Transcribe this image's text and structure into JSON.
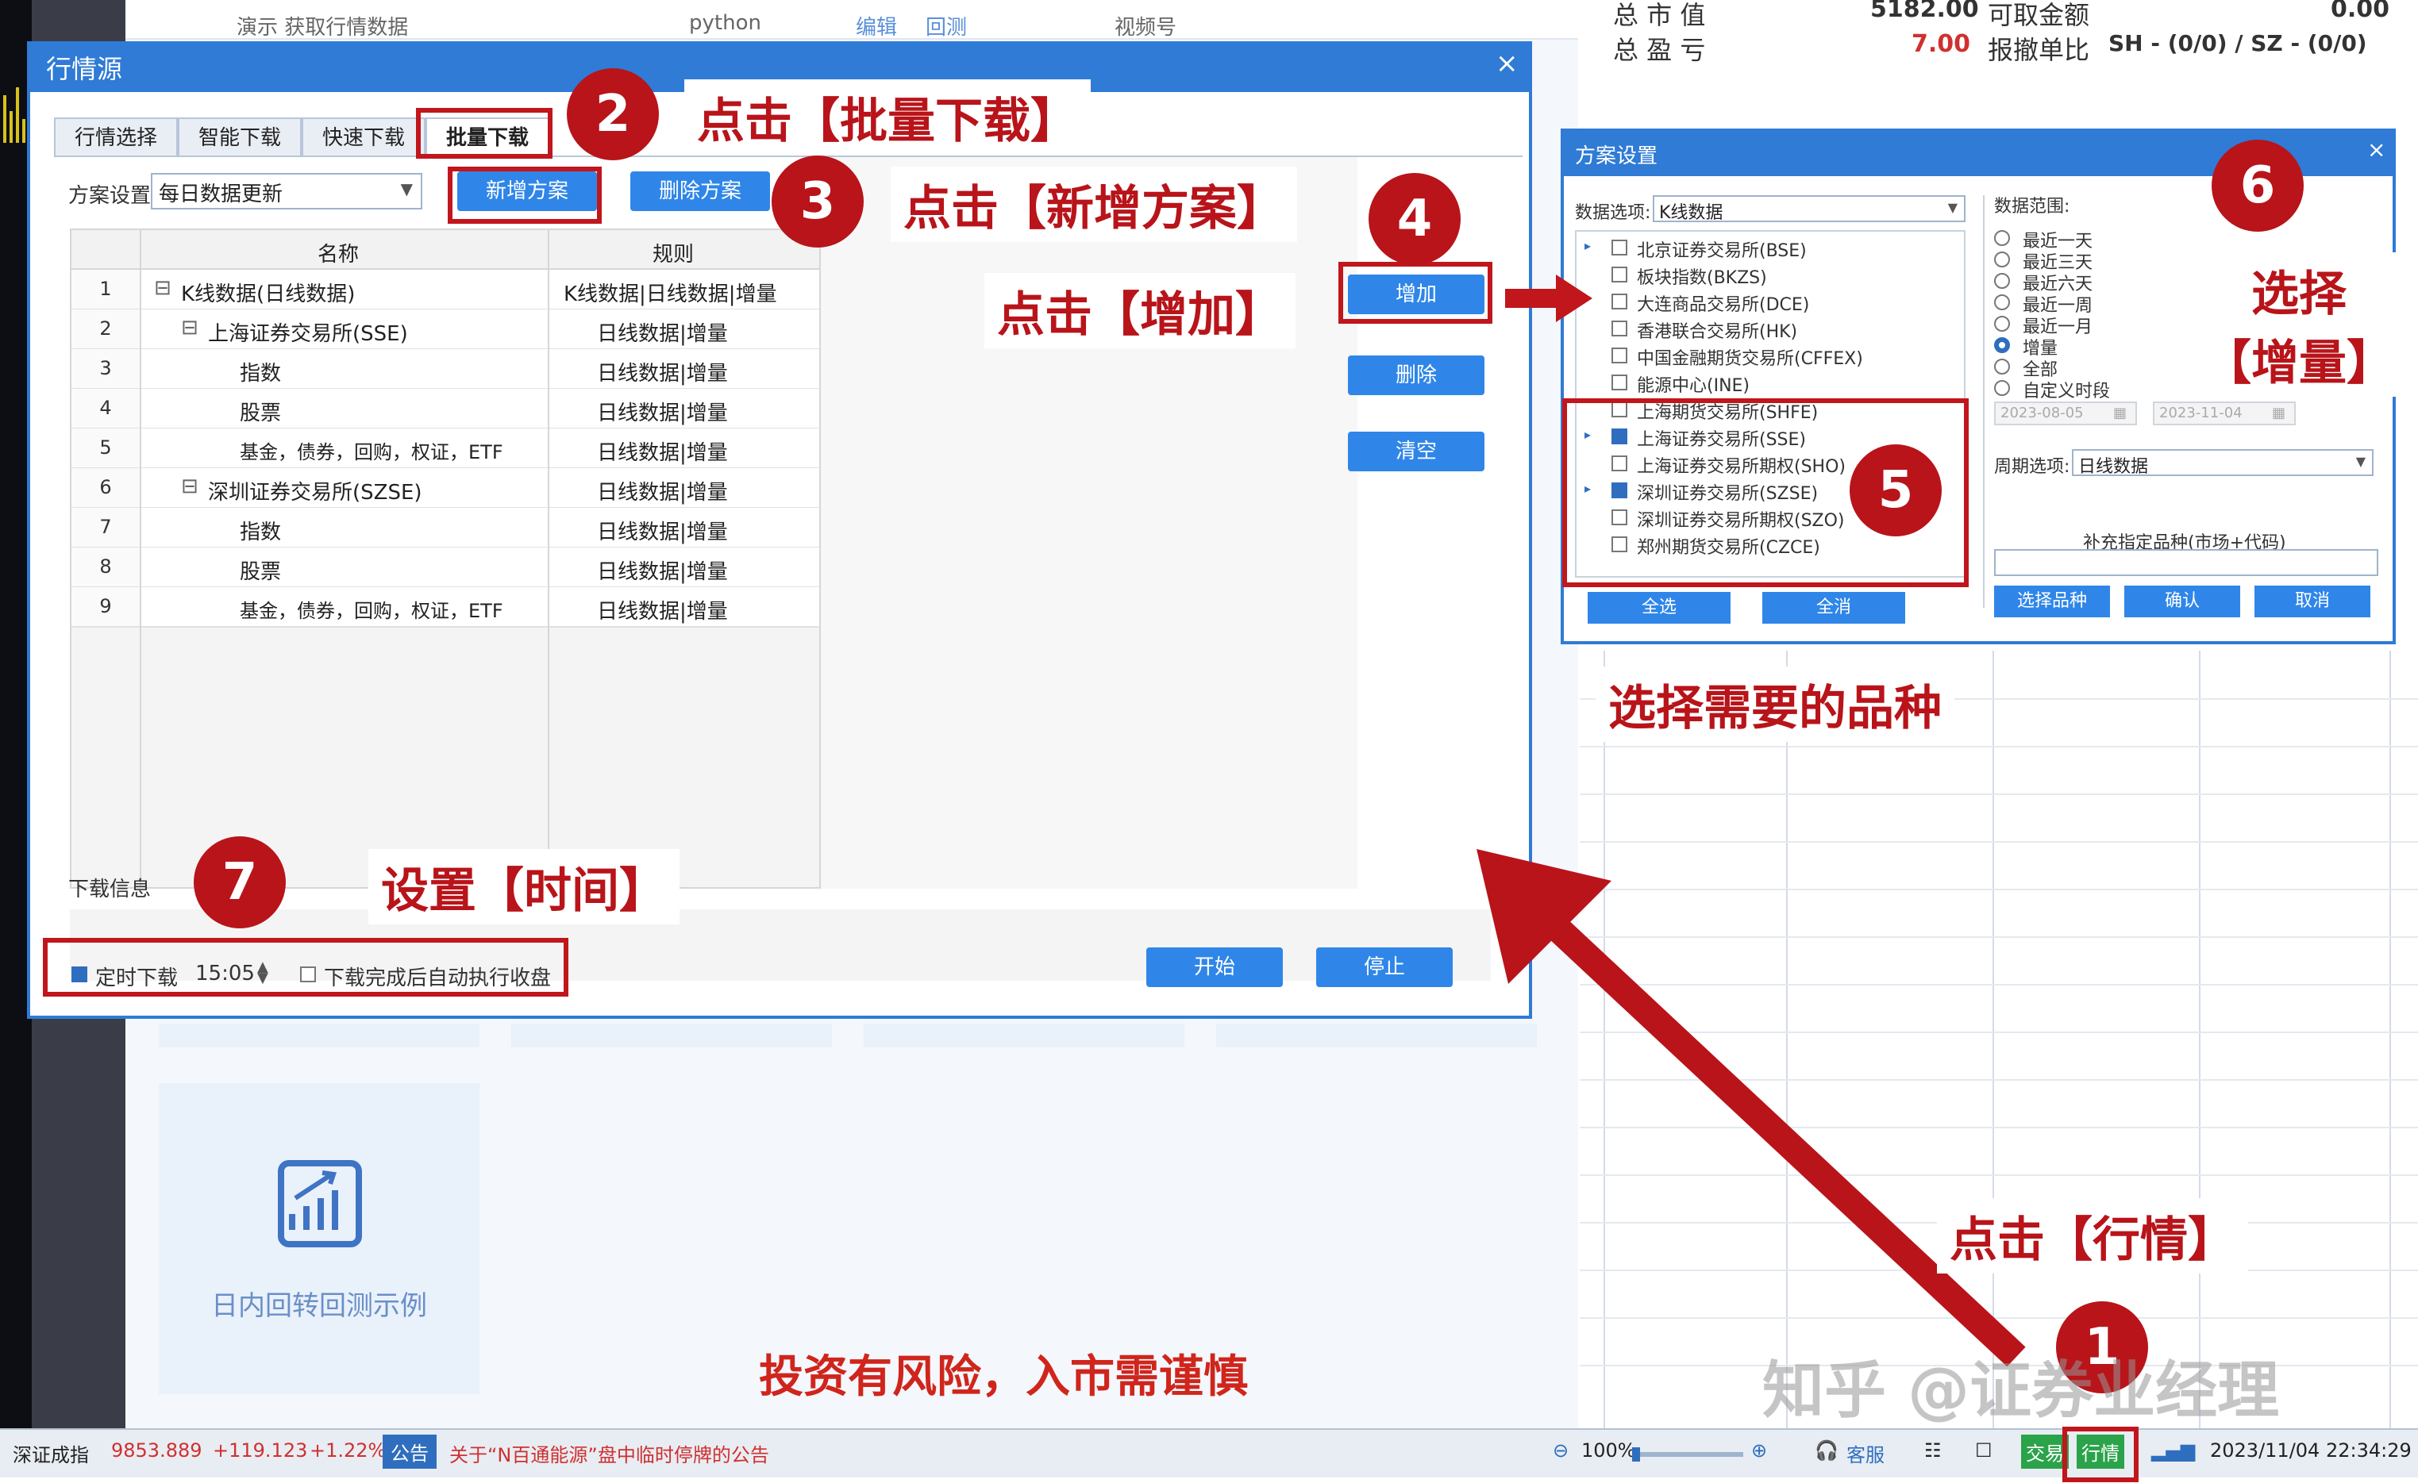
{
  "background": {
    "demo_row": {
      "name": "演示 获取行情数据",
      "lang": "python",
      "edit": "编辑",
      "backtest": "回测",
      "channel": "视频号"
    },
    "demo_card_label": "日内回转回测示例",
    "account": {
      "market_value_label": "总 市 值",
      "market_value": "5182.00",
      "withdrawable_label": "可取金额",
      "withdrawable": "0.00",
      "pnl_label": "总 盈 亏",
      "pnl": "7.00",
      "cancel_ratio_label": "报撤单比",
      "cancel_ratio": "SH - (0/0) / SZ - (0/0)"
    }
  },
  "main_dialog": {
    "title": "行情源",
    "close": "×",
    "tabs": [
      {
        "label": "行情选择"
      },
      {
        "label": "智能下载"
      },
      {
        "label": "快速下载"
      },
      {
        "label": "批量下载"
      }
    ],
    "plan_label": "方案设置",
    "plan_select": "每日数据更新",
    "btn_add_plan": "新增方案",
    "btn_delete_plan": "删除方案",
    "table": {
      "headers": [
        "名称",
        "规则"
      ],
      "rows": [
        {
          "num": "1",
          "name": "K线数据(日线数据)",
          "rule": "K线数据|日线数据|增量"
        },
        {
          "num": "2",
          "name": "上海证券交易所(SSE)",
          "rule": "日线数据|增量"
        },
        {
          "num": "3",
          "name": "指数",
          "rule": "日线数据|增量"
        },
        {
          "num": "4",
          "name": "股票",
          "rule": "日线数据|增量"
        },
        {
          "num": "5",
          "name": "基金，债券，回购，权证，ETF",
          "rule": "日线数据|增量"
        },
        {
          "num": "6",
          "name": "深圳证券交易所(SZSE)",
          "rule": "日线数据|增量"
        },
        {
          "num": "7",
          "name": "指数",
          "rule": "日线数据|增量"
        },
        {
          "num": "8",
          "name": "股票",
          "rule": "日线数据|增量"
        },
        {
          "num": "9",
          "name": "基金，债券，回购，权证，ETF",
          "rule": "日线数据|增量"
        }
      ]
    },
    "btn_add": "增加",
    "btn_delete": "删除",
    "btn_clear": "清空",
    "download_info_label": "下载信息",
    "timed_download_label": "定时下载",
    "timed_download_time": "15:05",
    "auto_close_label": "下载完成后自动执行收盘",
    "btn_start": "开始",
    "btn_stop": "停止"
  },
  "plan_dialog": {
    "title": "方案设置",
    "close": "×",
    "data_option_label": "数据选项:",
    "data_option_value": "K线数据",
    "markets": [
      {
        "label": "北京证券交易所(BSE)",
        "checked": false,
        "expander": true
      },
      {
        "label": "板块指数(BKZS)",
        "checked": false,
        "expander": false
      },
      {
        "label": "大连商品交易所(DCE)",
        "checked": false,
        "expander": false
      },
      {
        "label": "香港联合交易所(HK)",
        "checked": false,
        "expander": false
      },
      {
        "label": "中国金融期货交易所(CFFEX)",
        "checked": false,
        "expander": false
      },
      {
        "label": "能源中心(INE)",
        "checked": false,
        "expander": false
      },
      {
        "label": "上海期货交易所(SHFE)",
        "checked": false,
        "expander": false
      },
      {
        "label": "上海证券交易所(SSE)",
        "checked": true,
        "expander": true
      },
      {
        "label": "上海证券交易所期权(SHO)",
        "checked": false,
        "expander": false
      },
      {
        "label": "深圳证券交易所(SZSE)",
        "checked": true,
        "expander": true
      },
      {
        "label": "深圳证券交易所期权(SZO)",
        "checked": false,
        "expander": false
      },
      {
        "label": "郑州期货交易所(CZCE)",
        "checked": false,
        "expander": false
      }
    ],
    "btn_select_all": "全选",
    "btn_clear_all": "全消",
    "data_range_label": "数据范围:",
    "ranges": [
      {
        "label": "最近一天",
        "selected": false
      },
      {
        "label": "最近三天",
        "selected": false
      },
      {
        "label": "最近六天",
        "selected": false
      },
      {
        "label": "最近一周",
        "selected": false
      },
      {
        "label": "最近一月",
        "selected": false
      },
      {
        "label": "增量",
        "selected": true
      },
      {
        "label": "全部",
        "selected": false
      },
      {
        "label": "自定义时段",
        "selected": false
      }
    ],
    "date_from": "2023-08-05",
    "date_to": "2023-11-04",
    "period_label": "周期选项:",
    "period_value": "日线数据",
    "supplement_label": "补充指定品种(市场+代码)",
    "btn_select_variety": "选择品种",
    "btn_confirm": "确认",
    "btn_cancel": "取消"
  },
  "annotations": {
    "step1": "1",
    "step1_text": "点击【行情】",
    "step2": "2",
    "step2_text": "点击【批量下载】",
    "step3": "3",
    "step3_text": "点击【新增方案】",
    "step4": "4",
    "step4_text": "点击【增加】",
    "step5": "5",
    "step5_text": "选择需要的品种",
    "step6": "6",
    "step6_text_line1": "选择",
    "step6_text_line2": "【增量】",
    "step7": "7",
    "step7_text": "设置【时间】",
    "disclaimer": "投资有风险，入市需谨慎",
    "watermark": "知乎 @证券业经理",
    "accent_color": "#b8141a"
  },
  "statusbar": {
    "index_name": "深证成指",
    "index_value": "9853.889",
    "index_change": "+119.123",
    "index_pct": "+1.22%",
    "notice_label": "公告",
    "notice_text": "关于“N百通能源”盘中临时停牌的公告",
    "zoom": "100%",
    "service": "客服",
    "trade": "交易",
    "market": "行情",
    "datetime": "2023/11/04 22:34:29"
  }
}
